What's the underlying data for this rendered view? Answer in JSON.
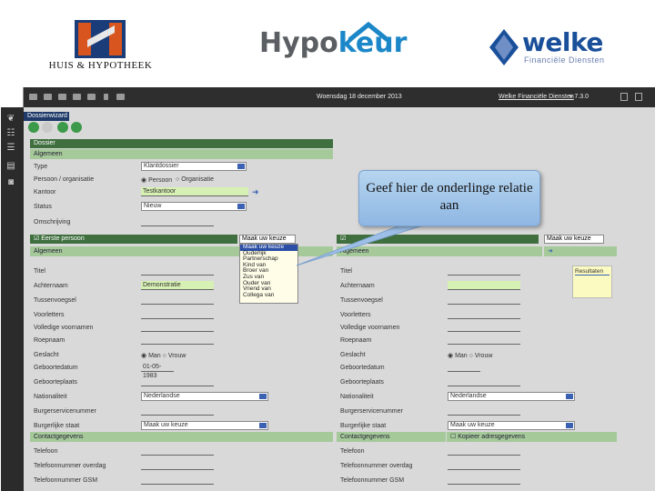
{
  "logos": {
    "huis_hypotheek": "HUIS & HYPOTHEEK",
    "hypokeur_part1": "Hypo",
    "hypokeur_part2": "keur",
    "welke_big": "welke",
    "welke_small": "Financiële Diensten"
  },
  "topbar": {
    "date": "Woensdag 18 december 2013",
    "user": "Welke Financiële Diensten",
    "version": "v 7.3.0"
  },
  "wizard": {
    "title": "Dossierwizard"
  },
  "dossier": {
    "header": "Dossier",
    "section": "Algemeen",
    "fields": [
      {
        "label": "Type",
        "value": "Klantdossier"
      },
      {
        "label": "Persoon / organisatie",
        "options": [
          "Persoon",
          "Organisatie"
        ]
      },
      {
        "label": "Kantoor",
        "value": "Testkantoor"
      },
      {
        "label": "Status",
        "value": "Nieuw"
      },
      {
        "label": "Omschrijving",
        "value": ""
      }
    ]
  },
  "left_person": {
    "header": "Eerste persoon",
    "section": "Algemeen",
    "relation_select": "Maak uw keuze",
    "labels": [
      "Titel",
      "Achternaam",
      "Tussenvoegsel",
      "Voorletters",
      "Volledige voornamen",
      "Roepnaam",
      "Geslacht",
      "Geboortedatum",
      "Geboorteplaats",
      "Nationaliteit",
      "Burgerservicenummer",
      "Burgerlijke staat"
    ],
    "achternaam": "Demonstratie",
    "gender_options": [
      "Man",
      "Vrouw"
    ],
    "birthdate": "01-05-1983",
    "nationality": "Nederlandse",
    "civil_state": "Maak uw keuze",
    "contact_section": "Contactgegevens",
    "contact_labels": [
      "Telefoon",
      "Telefoonnummer overdag",
      "Telefoonnummer GSM"
    ]
  },
  "right_person": {
    "relation_select": "Maak uw keuze",
    "section": "Algemeen",
    "labels": [
      "Titel",
      "Achternaam",
      "Tussenvoegsel",
      "Voorletters",
      "Volledige voornamen",
      "Roepnaam",
      "Geslacht",
      "Geboortedatum",
      "Geboorteplaats",
      "Nationaliteit",
      "Burgerservicenummer",
      "Burgerlijke staat"
    ],
    "gender_options": [
      "Man",
      "Vrouw"
    ],
    "nationality": "Nederlandse",
    "civil_state": "Maak uw keuze",
    "result_label": "Resultaten",
    "contact_section": "Contactgegevens",
    "contact_copy": "Kopieer adresgegevens",
    "contact_labels": [
      "Telefoon",
      "Telefoonnummer overdag",
      "Telefoonnummer GSM"
    ]
  },
  "dropdown_options": [
    "Maak uw keuze",
    "Ouderlijk",
    "Partnerschap",
    "Kind van",
    "Broer van",
    "Zus van",
    "Ouder van",
    "Vriend van",
    "Collega van"
  ],
  "dropdown_selected_index": 0,
  "callout": {
    "text": "Geef hier de onderlinge relatie aan"
  },
  "colors": {
    "section_green": "#a6c99a",
    "accent_blue": "#1b87c8",
    "callout": "#a9cbee"
  }
}
